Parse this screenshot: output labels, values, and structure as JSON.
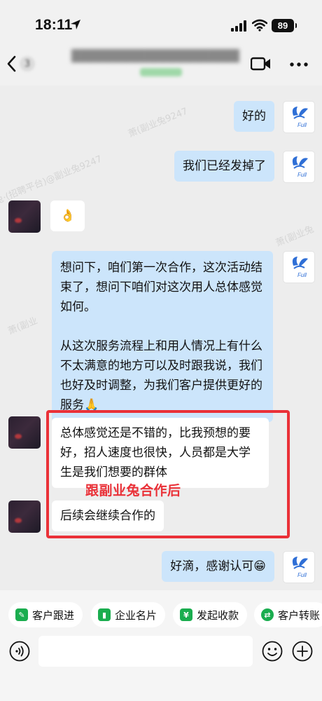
{
  "status_bar": {
    "time": "18:11",
    "battery": "89"
  },
  "nav": {
    "unread": "3"
  },
  "watermarks": [
    "萧(副业兔9247",
    "兔·(招聘平台)@副业兔9247",
    "萧(副业兔",
    "萧(副业"
  ],
  "messages": [
    {
      "from": "self",
      "paragraphs": [
        "好的"
      ]
    },
    {
      "from": "self",
      "paragraphs": [
        "我们已经发掉了"
      ]
    },
    {
      "from": "other",
      "paragraphs": [
        "👌"
      ]
    },
    {
      "from": "self",
      "paragraphs": [
        "想问下，咱们第一次合作，这次活动结束了，想问下咱们对这次用人总体感觉如何。",
        "从这次服务流程上和用人情况上有什么不太满意的地方可以及时跟我说，我们也好及时调整，为我们客户提供更好的服务🙏"
      ]
    },
    {
      "from": "other",
      "paragraphs": [
        "总体感觉还是不错的，比我预想的要好，招人速度也很快，人员都是大学生是我们想要的群体"
      ]
    },
    {
      "from": "other",
      "paragraphs": [
        "后续会继续合作的"
      ]
    },
    {
      "from": "self",
      "paragraphs": [
        "好滴，感谢认可😁"
      ]
    }
  ],
  "annotation": "跟副业兔合作后",
  "self_avatar_text": "Full",
  "quick_actions": [
    {
      "label": "客户跟进",
      "icon": "follow-up-icon"
    },
    {
      "label": "企业名片",
      "icon": "business-card-icon"
    },
    {
      "label": "发起收款",
      "icon": "payment-icon"
    },
    {
      "label": "客户转账",
      "icon": "transfer-icon"
    }
  ],
  "input": {
    "placeholder": ""
  },
  "colors": {
    "self_bubble": "#cce5fb",
    "other_bubble": "#ffffff",
    "highlight_red": "#ea3138",
    "chip_green": "#1aad4f"
  }
}
